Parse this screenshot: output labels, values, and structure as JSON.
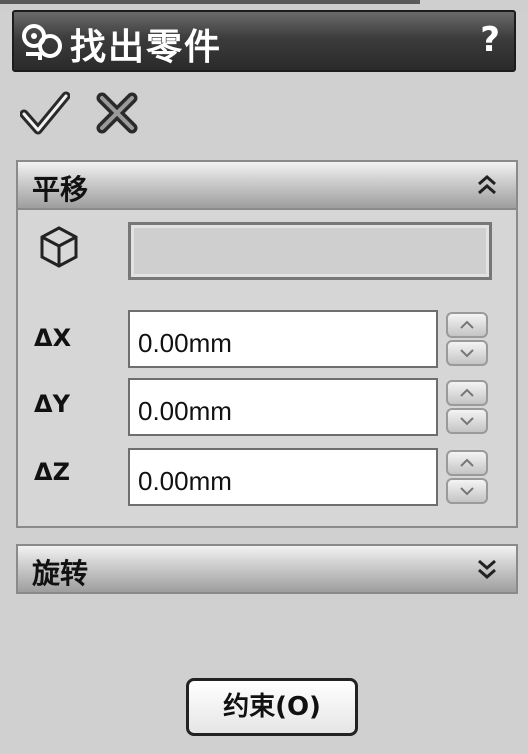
{
  "window": {
    "title": "找出零件",
    "help_label": "?"
  },
  "actions": {
    "ok_icon": "checkmark-icon",
    "cancel_icon": "x-icon"
  },
  "translate_group": {
    "title": "平移",
    "fields": [
      {
        "label": "ΔX",
        "value": "0.00mm"
      },
      {
        "label": "ΔY",
        "value": "0.00mm"
      },
      {
        "label": "ΔZ",
        "value": "0.00mm"
      }
    ]
  },
  "rotate_group": {
    "title": "旋转"
  },
  "footer": {
    "constrain_label": "约束(O)"
  }
}
